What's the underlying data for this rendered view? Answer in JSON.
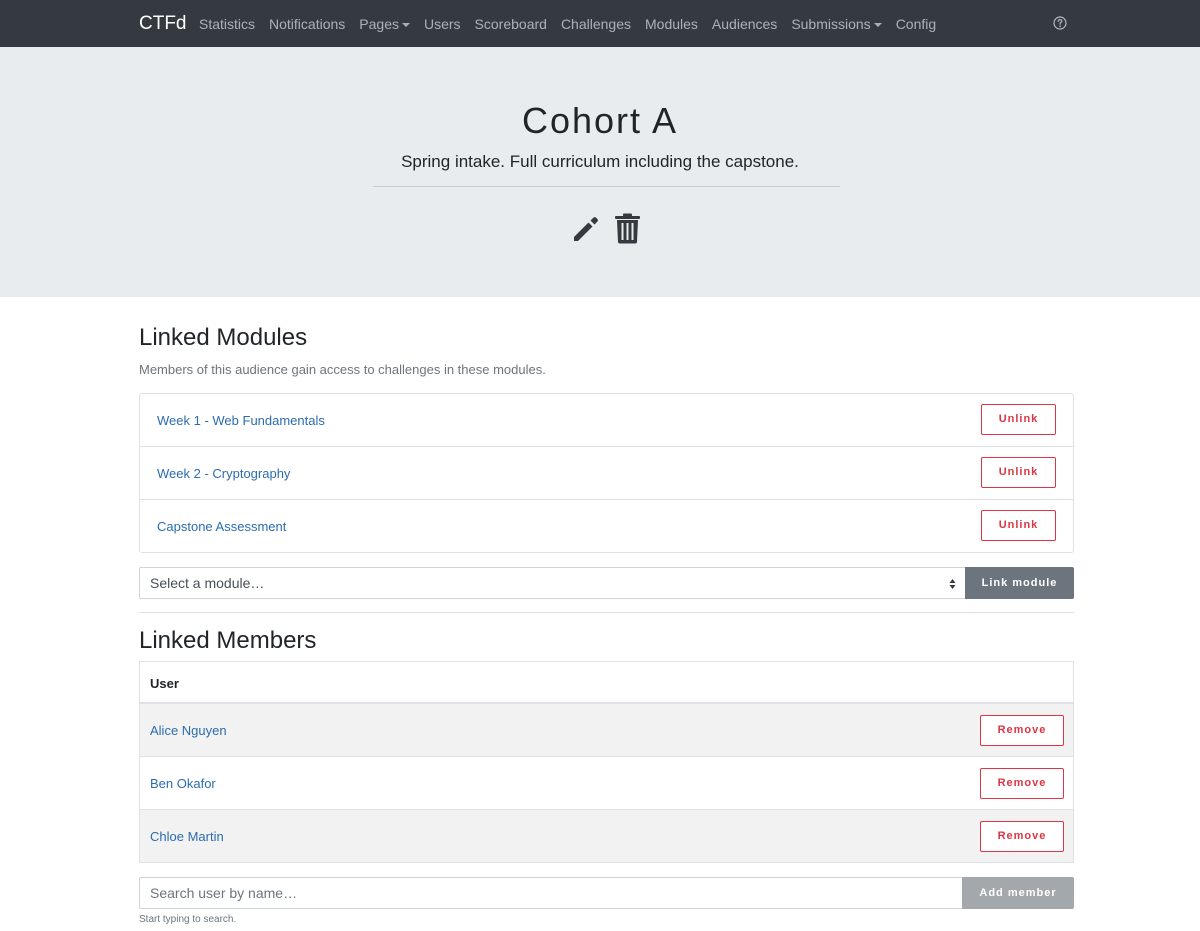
{
  "navbar": {
    "brand": "CTFd",
    "items": [
      {
        "label": "Statistics",
        "dropdown": false
      },
      {
        "label": "Notifications",
        "dropdown": false
      },
      {
        "label": "Pages",
        "dropdown": true
      },
      {
        "label": "Users",
        "dropdown": false
      },
      {
        "label": "Scoreboard",
        "dropdown": false
      },
      {
        "label": "Challenges",
        "dropdown": false
      },
      {
        "label": "Modules",
        "dropdown": false
      },
      {
        "label": "Audiences",
        "dropdown": false
      },
      {
        "label": "Submissions",
        "dropdown": true
      },
      {
        "label": "Config",
        "dropdown": false
      }
    ],
    "help_icon": "question-circle-icon"
  },
  "header": {
    "title": "Cohort A",
    "description": "Spring intake. Full curriculum including the capstone.",
    "edit_icon": "pencil-icon",
    "delete_icon": "trash-icon"
  },
  "modules_section": {
    "title": "Linked Modules",
    "description": "Members of this audience gain access to challenges in these modules.",
    "items": [
      {
        "name": "Week 1 - Web Fundamentals",
        "action": "Unlink"
      },
      {
        "name": "Week 2 - Cryptography",
        "action": "Unlink"
      },
      {
        "name": "Capstone Assessment",
        "action": "Unlink"
      }
    ],
    "select_placeholder": "Select a module…",
    "link_button": "Link module"
  },
  "members_section": {
    "title": "Linked Members",
    "column_header": "User",
    "rows": [
      {
        "name": "Alice Nguyen",
        "action": "Remove"
      },
      {
        "name": "Ben Okafor",
        "action": "Remove"
      },
      {
        "name": "Chloe Martin",
        "action": "Remove"
      }
    ],
    "search_placeholder": "Search user by name…",
    "add_button": "Add member",
    "hint": "Start typing to search."
  },
  "colors": {
    "navbar_bg": "#343a40",
    "jumbotron_bg": "#e9ecef",
    "link": "#2b6cb0",
    "danger": "#dc3545",
    "secondary": "#6c757d"
  }
}
